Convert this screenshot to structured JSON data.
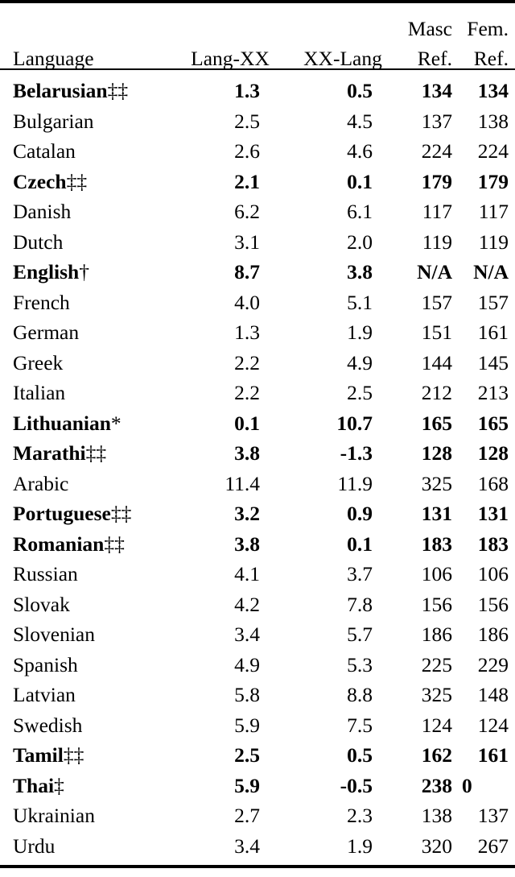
{
  "table": {
    "columns": [
      {
        "key": "language",
        "label": "Language",
        "align": "left"
      },
      {
        "key": "lang_xx",
        "label": "Lang-XX",
        "align": "center"
      },
      {
        "key": "xx_lang",
        "label": "XX-Lang",
        "align": "center"
      },
      {
        "key": "masc_ref",
        "label": "Masc",
        "sublabel": "Ref.",
        "align": "right"
      },
      {
        "key": "fem_ref",
        "label": "Fem.",
        "sublabel": "Ref.",
        "align": "right"
      }
    ],
    "header": {
      "language": "Language",
      "lang_xx": "Lang-XX",
      "xx_lang": "XX-Lang",
      "masc": "Masc",
      "fem": "Fem.",
      "masc_ref": "Ref.",
      "fem_ref": "Ref."
    },
    "rows": [
      {
        "language": "Belarusian",
        "marker": "‡‡",
        "lang_xx": "1.3",
        "xx_lang": "0.5",
        "masc_ref": "134",
        "fem_ref": "134",
        "bold": true
      },
      {
        "language": "Bulgarian",
        "marker": "",
        "lang_xx": "2.5",
        "xx_lang": "4.5",
        "masc_ref": "137",
        "fem_ref": "138",
        "bold": false
      },
      {
        "language": "Catalan",
        "marker": "",
        "lang_xx": "2.6",
        "xx_lang": "4.6",
        "masc_ref": "224",
        "fem_ref": "224",
        "bold": false
      },
      {
        "language": "Czech",
        "marker": "‡‡",
        "lang_xx": "2.1",
        "xx_lang": "0.1",
        "masc_ref": "179",
        "fem_ref": "179",
        "bold": true
      },
      {
        "language": "Danish",
        "marker": "",
        "lang_xx": "6.2",
        "xx_lang": "6.1",
        "masc_ref": "117",
        "fem_ref": "117",
        "bold": false
      },
      {
        "language": "Dutch",
        "marker": "",
        "lang_xx": "3.1",
        "xx_lang": "2.0",
        "masc_ref": "119",
        "fem_ref": "119",
        "bold": false
      },
      {
        "language": "English",
        "marker": "†",
        "lang_xx": "8.7",
        "xx_lang": "3.8",
        "masc_ref": "N/A",
        "fem_ref": "N/A",
        "bold": true
      },
      {
        "language": "French",
        "marker": "",
        "lang_xx": "4.0",
        "xx_lang": "5.1",
        "masc_ref": "157",
        "fem_ref": "157",
        "bold": false
      },
      {
        "language": "German",
        "marker": "",
        "lang_xx": "1.3",
        "xx_lang": "1.9",
        "masc_ref": "151",
        "fem_ref": "161",
        "bold": false
      },
      {
        "language": "Greek",
        "marker": "",
        "lang_xx": "2.2",
        "xx_lang": "4.9",
        "masc_ref": "144",
        "fem_ref": "145",
        "bold": false
      },
      {
        "language": "Italian",
        "marker": "",
        "lang_xx": "2.2",
        "xx_lang": "2.5",
        "masc_ref": "212",
        "fem_ref": "213",
        "bold": false
      },
      {
        "language": "Lithuanian",
        "marker": "*",
        "lang_xx": "0.1",
        "xx_lang": "10.7",
        "masc_ref": "165",
        "fem_ref": "165",
        "bold": true
      },
      {
        "language": "Marathi",
        "marker": "‡‡",
        "lang_xx": "3.8",
        "xx_lang": "-1.3",
        "masc_ref": "128",
        "fem_ref": "128",
        "bold": true
      },
      {
        "language": "Arabic",
        "marker": "",
        "lang_xx": "11.4",
        "xx_lang": "11.9",
        "masc_ref": "325",
        "fem_ref": "168",
        "bold": false
      },
      {
        "language": "Portuguese",
        "marker": "‡‡",
        "lang_xx": "3.2",
        "xx_lang": "0.9",
        "masc_ref": "131",
        "fem_ref": "131",
        "bold": true
      },
      {
        "language": "Romanian",
        "marker": "‡‡",
        "lang_xx": "3.8",
        "xx_lang": "0.1",
        "masc_ref": "183",
        "fem_ref": "183",
        "bold": true
      },
      {
        "language": "Russian",
        "marker": "",
        "lang_xx": "4.1",
        "xx_lang": "3.7",
        "masc_ref": "106",
        "fem_ref": "106",
        "bold": false
      },
      {
        "language": "Slovak",
        "marker": "",
        "lang_xx": "4.2",
        "xx_lang": "7.8",
        "masc_ref": "156",
        "fem_ref": "156",
        "bold": false
      },
      {
        "language": "Slovenian",
        "marker": "",
        "lang_xx": "3.4",
        "xx_lang": "5.7",
        "masc_ref": "186",
        "fem_ref": "186",
        "bold": false
      },
      {
        "language": "Spanish",
        "marker": "",
        "lang_xx": "4.9",
        "xx_lang": "5.3",
        "masc_ref": "225",
        "fem_ref": "229",
        "bold": false
      },
      {
        "language": "Latvian",
        "marker": "",
        "lang_xx": "5.8",
        "xx_lang": "8.8",
        "masc_ref": "325",
        "fem_ref": "148",
        "bold": false
      },
      {
        "language": "Swedish",
        "marker": "",
        "lang_xx": "5.9",
        "xx_lang": "7.5",
        "masc_ref": "124",
        "fem_ref": "124",
        "bold": false
      },
      {
        "language": "Tamil",
        "marker": "‡‡",
        "lang_xx": "2.5",
        "xx_lang": "0.5",
        "masc_ref": "162",
        "fem_ref": "161",
        "bold": true
      },
      {
        "language": "Thai",
        "marker": "‡",
        "lang_xx": "5.9",
        "xx_lang": "-0.5",
        "masc_ref": "238",
        "fem_ref": "0",
        "bold": true,
        "fem_left": true
      },
      {
        "language": "Ukrainian",
        "marker": "",
        "lang_xx": "2.7",
        "xx_lang": "2.3",
        "masc_ref": "138",
        "fem_ref": "137",
        "bold": false
      },
      {
        "language": "Urdu",
        "marker": "",
        "lang_xx": "3.4",
        "xx_lang": "1.9",
        "masc_ref": "320",
        "fem_ref": "267",
        "bold": false
      }
    ]
  },
  "chart_data": {
    "type": "table",
    "title": "",
    "columns": [
      "Language",
      "Lang-XX",
      "XX-Lang",
      "Masc Ref.",
      "Fem. Ref."
    ],
    "rows": [
      [
        "Belarusian‡‡",
        1.3,
        0.5,
        134,
        134
      ],
      [
        "Bulgarian",
        2.5,
        4.5,
        137,
        138
      ],
      [
        "Catalan",
        2.6,
        4.6,
        224,
        224
      ],
      [
        "Czech‡‡",
        2.1,
        0.1,
        179,
        179
      ],
      [
        "Danish",
        6.2,
        6.1,
        117,
        117
      ],
      [
        "Dutch",
        3.1,
        2.0,
        119,
        119
      ],
      [
        "English†",
        8.7,
        3.8,
        "N/A",
        "N/A"
      ],
      [
        "French",
        4.0,
        5.1,
        157,
        157
      ],
      [
        "German",
        1.3,
        1.9,
        151,
        161
      ],
      [
        "Greek",
        2.2,
        4.9,
        144,
        145
      ],
      [
        "Italian",
        2.2,
        2.5,
        212,
        213
      ],
      [
        "Lithuanian*",
        0.1,
        10.7,
        165,
        165
      ],
      [
        "Marathi‡‡",
        3.8,
        -1.3,
        128,
        128
      ],
      [
        "Arabic",
        11.4,
        11.9,
        325,
        168
      ],
      [
        "Portuguese‡‡",
        3.2,
        0.9,
        131,
        131
      ],
      [
        "Romanian‡‡",
        3.8,
        0.1,
        183,
        183
      ],
      [
        "Russian",
        4.1,
        3.7,
        106,
        106
      ],
      [
        "Slovak",
        4.2,
        7.8,
        156,
        156
      ],
      [
        "Slovenian",
        3.4,
        5.7,
        186,
        186
      ],
      [
        "Spanish",
        4.9,
        5.3,
        225,
        229
      ],
      [
        "Latvian",
        5.8,
        8.8,
        325,
        148
      ],
      [
        "Swedish",
        5.9,
        7.5,
        124,
        124
      ],
      [
        "Tamil‡‡",
        2.5,
        0.5,
        162,
        161
      ],
      [
        "Thai‡",
        5.9,
        -0.5,
        238,
        0
      ],
      [
        "Ukrainian",
        2.7,
        2.3,
        138,
        137
      ],
      [
        "Urdu",
        3.4,
        1.9,
        320,
        267
      ]
    ]
  }
}
